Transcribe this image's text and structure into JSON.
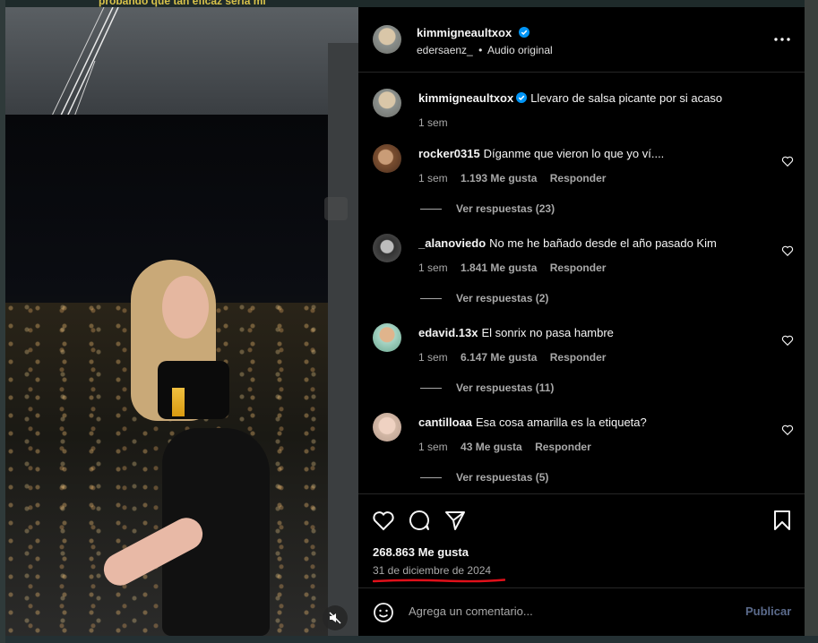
{
  "background": {
    "caption_strip": "probando que tan eficaz sería mi"
  },
  "media": {
    "mute_icon": "speaker-muted-icon"
  },
  "post": {
    "author": "kimmigneaultxox",
    "audio_user": "edersaenz_",
    "audio_sep": "•",
    "audio_label": "Audio original",
    "caption": {
      "user": "kimmigneaultxox",
      "text": "Llevaro de salsa picante por si acaso",
      "time": "1 sem"
    },
    "comments": [
      {
        "user": "rocker0315",
        "text": "Díganme que vieron lo que yo ví....",
        "time": "1 sem",
        "likes": "1.193 Me gusta",
        "reply": "Responder",
        "replies": "Ver respuestas (23)"
      },
      {
        "user": "_alanoviedo",
        "text": "No me he bañado desde el año pasado Kim",
        "time": "1 sem",
        "likes": "1.841 Me gusta",
        "reply": "Responder",
        "replies": "Ver respuestas (2)"
      },
      {
        "user": "edavid.13x",
        "text": "El sonrix no pasa hambre",
        "time": "1 sem",
        "likes": "6.147 Me gusta",
        "reply": "Responder",
        "replies": "Ver respuestas (11)"
      },
      {
        "user": "cantilloaa",
        "text": "Esa cosa amarilla es la etiqueta?",
        "time": "1 sem",
        "likes": "43 Me gusta",
        "reply": "Responder",
        "replies": "Ver respuestas (5)"
      }
    ],
    "likes_count": "268.863 Me gusta",
    "date": "31 de diciembre de 2024",
    "underline_color": "#e0101a"
  },
  "composer": {
    "placeholder": "Agrega un comentario...",
    "publish": "Publicar"
  },
  "colors": {
    "verified": "#0095f6",
    "muted_text": "#a8a8a8",
    "publish": "#5b6b8c"
  }
}
